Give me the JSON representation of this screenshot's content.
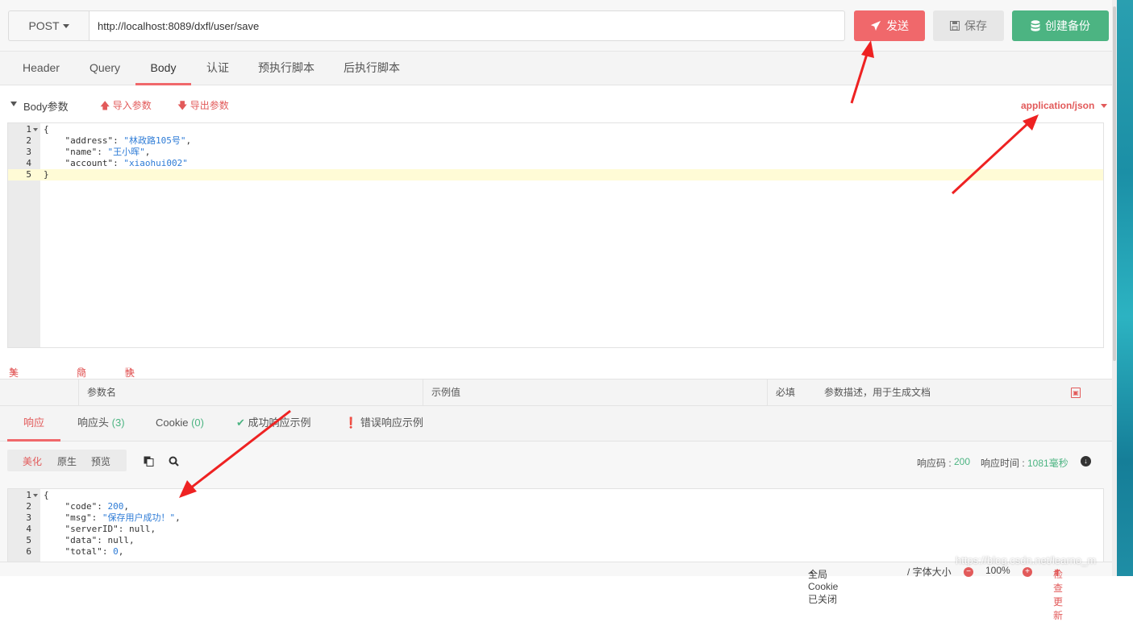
{
  "request": {
    "method": "POST",
    "url": "http://localhost:8089/dxfl/user/save",
    "send_label": "发送",
    "save_label": "保存",
    "backup_label": "创建备份"
  },
  "tabs": [
    "Header",
    "Query",
    "Body",
    "认证",
    "预执行脚本",
    "后执行脚本"
  ],
  "active_tab": "Body",
  "body": {
    "section_label": "Body参数",
    "import_label": "导入参数",
    "export_label": "导出参数",
    "content_type": "application/json",
    "lines": [
      {
        "no": "1",
        "text": "{"
      },
      {
        "no": "2",
        "key": "\"address\"",
        "val": "\"林政路105号\"",
        "trail": ","
      },
      {
        "no": "3",
        "key": "\"name\"",
        "val": "\"王小晖\"",
        "trail": ","
      },
      {
        "no": "4",
        "key": "\"account\"",
        "val": "\"xiaohui002\"",
        "trail": ""
      },
      {
        "no": "5",
        "text": "}"
      }
    ],
    "actions": {
      "beautify": "美化格式",
      "simplify": "简化",
      "export_fields": "快速导出到字段描述"
    }
  },
  "params_table": {
    "col_name": "参数名",
    "col_example": "示例值",
    "col_required": "必填",
    "col_desc": "参数描述，用于生成文档"
  },
  "response": {
    "tabs": {
      "response": "响应",
      "headers": "响应头",
      "headers_count": "(3)",
      "cookie": "Cookie",
      "cookie_count": "(0)",
      "success_example": "成功响应示例",
      "error_example": "错误响应示例"
    },
    "view_modes": [
      "美化",
      "原生",
      "预览"
    ],
    "status_code_label": "响应码 :",
    "status_code": "200",
    "time_label": "响应时间 :",
    "time_value": "1081毫秒",
    "lines": [
      {
        "no": "1",
        "text": "{"
      },
      {
        "no": "2",
        "key": "\"code\"",
        "val": "200",
        "trail": ","
      },
      {
        "no": "3",
        "key": "\"msg\"",
        "val": "\"保存用户成功！\"",
        "trail": ","
      },
      {
        "no": "4",
        "key": "\"serverID\"",
        "val": "null",
        "trail": ","
      },
      {
        "no": "5",
        "key": "\"data\"",
        "val": "null",
        "trail": ","
      },
      {
        "no": "6",
        "key": "\"total\"",
        "val": "0",
        "trail": ","
      }
    ]
  },
  "statusbar": {
    "cookie": "全局Cookie已关闭",
    "font_size": "/ 字体大小",
    "zoom": "100%",
    "update": "检查更新"
  },
  "watermark": "https://blog.csdn.net/learno_m",
  "colors": {
    "accent": "#f0686b",
    "green": "#4cb482",
    "arrow": "#ee2222"
  }
}
